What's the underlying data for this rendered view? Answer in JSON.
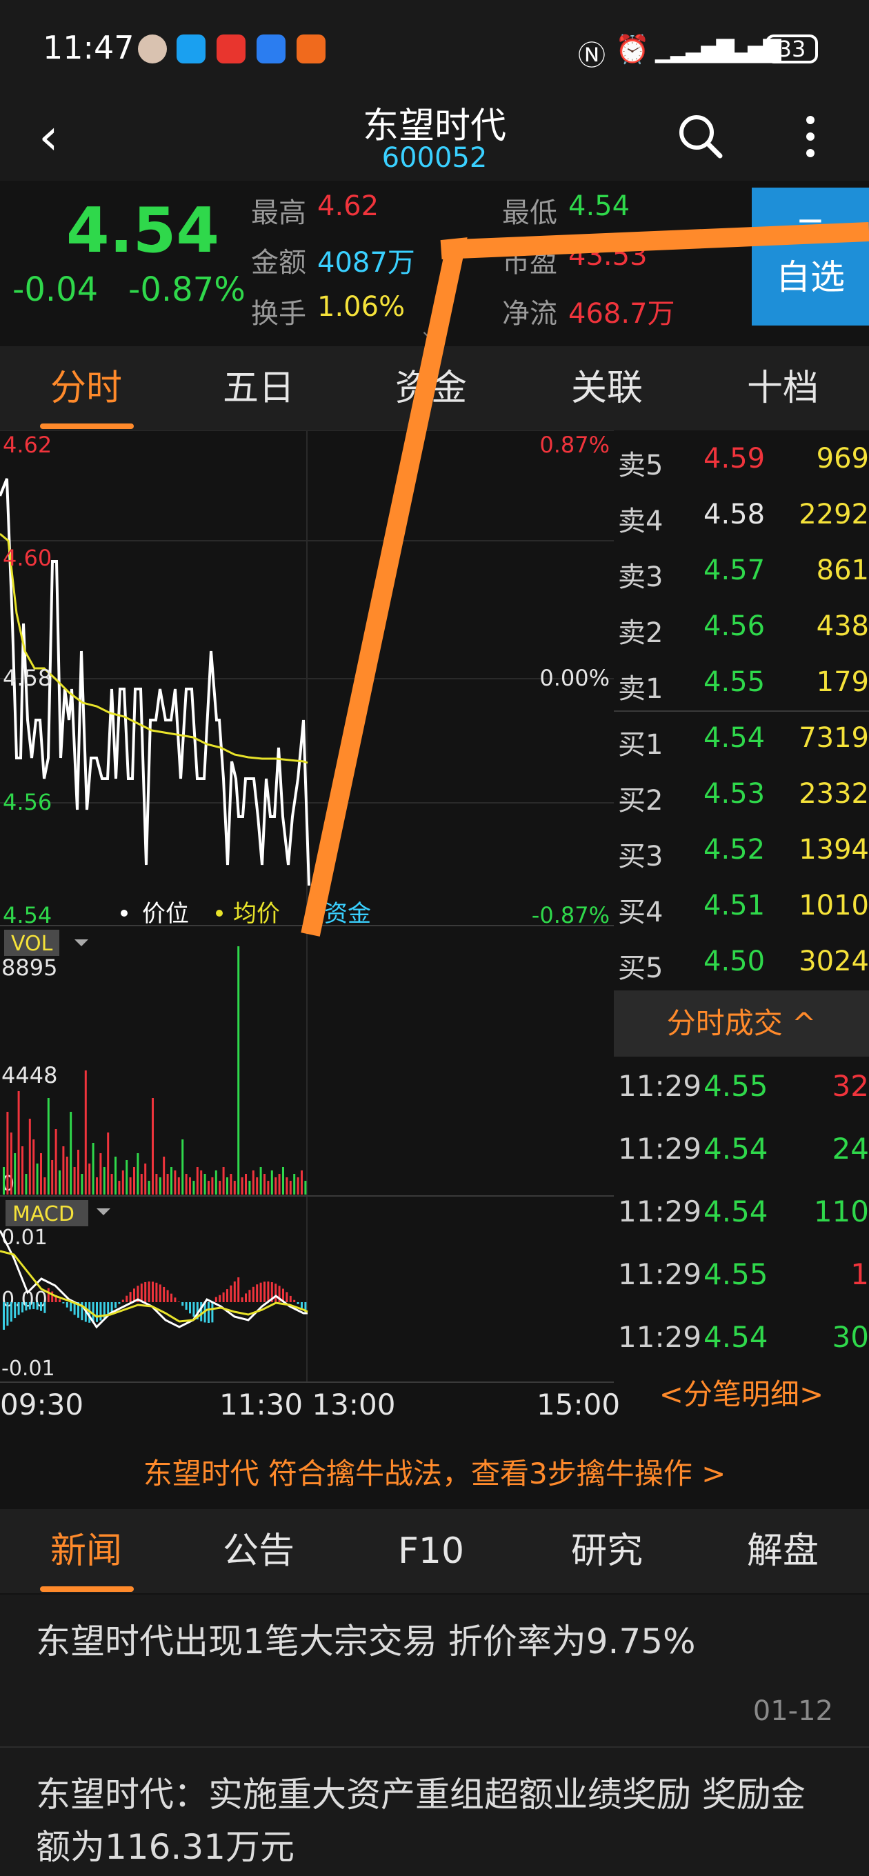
{
  "status": {
    "time": "11:47",
    "battery": "33"
  },
  "header": {
    "title": "东望时代",
    "code": "600052"
  },
  "quote": {
    "price": "4.54",
    "change": "-0.04",
    "change_pct": "-0.87%",
    "high_label": "最高",
    "high": "4.62",
    "low_label": "最低",
    "low": "4.54",
    "amount_label": "金额",
    "amount": "4087万",
    "pe_label": "市盈",
    "pe": "43.53",
    "turnover_label": "换手",
    "turnover": "1.06%",
    "netflow_label": "净流",
    "netflow": "468.7万",
    "fav_minus": "−",
    "fav_label": "自选"
  },
  "chart_tabs": [
    "分时",
    "五日",
    "资金",
    "关联",
    "十档"
  ],
  "chart": {
    "y_labels": [
      "4.62",
      "4.60",
      "4.58",
      "4.56",
      "4.54"
    ],
    "pct_top": "0.87%",
    "pct_mid": "0.00%",
    "pct_bottom": "-0.87%",
    "legend": [
      "价位",
      "均价",
      "资金"
    ],
    "vol_label": "VOL",
    "vol_top": "8895",
    "vol_mid": "4448",
    "vol_zero": "0",
    "macd_label": "MACD",
    "macd_top": "0.01",
    "macd_mid": "0.00",
    "macd_bottom": "-0.01",
    "x_labels": [
      "09:30",
      "11:30 13:00",
      "15:00"
    ]
  },
  "orderbook": [
    {
      "label": "卖5",
      "price": "4.59",
      "vol": "969",
      "color": "#f0343c"
    },
    {
      "label": "卖4",
      "price": "4.58",
      "vol": "2292",
      "color": "#e6e6e6"
    },
    {
      "label": "卖3",
      "price": "4.57",
      "vol": "861",
      "color": "#2fd84b"
    },
    {
      "label": "卖2",
      "price": "4.56",
      "vol": "438",
      "color": "#2fd84b"
    },
    {
      "label": "卖1",
      "price": "4.55",
      "vol": "179",
      "color": "#2fd84b"
    },
    {
      "label": "买1",
      "price": "4.54",
      "vol": "7319",
      "color": "#2fd84b"
    },
    {
      "label": "买2",
      "price": "4.53",
      "vol": "2332",
      "color": "#2fd84b"
    },
    {
      "label": "买3",
      "price": "4.52",
      "vol": "1394",
      "color": "#2fd84b"
    },
    {
      "label": "买4",
      "price": "4.51",
      "vol": "1010",
      "color": "#2fd84b"
    },
    {
      "label": "买5",
      "price": "4.50",
      "vol": "3024",
      "color": "#2fd84b"
    }
  ],
  "trades_header": "分时成交 ^",
  "trades": [
    {
      "time": "11:29",
      "price": "4.55",
      "vol": "32",
      "vcolor": "#f0343c"
    },
    {
      "time": "11:29",
      "price": "4.54",
      "vol": "24",
      "vcolor": "#2fd84b"
    },
    {
      "time": "11:29",
      "price": "4.54",
      "vol": "110",
      "vcolor": "#2fd84b"
    },
    {
      "time": "11:29",
      "price": "4.55",
      "vol": "1",
      "vcolor": "#f0343c"
    },
    {
      "time": "11:29",
      "price": "4.54",
      "vol": "30",
      "vcolor": "#2fd84b"
    }
  ],
  "trades_more": "<分笔明细>",
  "promo": "东望时代 符合擒牛战法，查看3步擒牛操作 >",
  "news_tabs": [
    "新闻",
    "公告",
    "F10",
    "研究",
    "解盘"
  ],
  "news": [
    {
      "title": "东望时代出现1笔大宗交易 折价率为9.75%",
      "date": "01-12"
    },
    {
      "title": "东望时代：实施重大资产重组超额业绩奖励 奖励金额为116.31万元",
      "date": ""
    }
  ]
}
